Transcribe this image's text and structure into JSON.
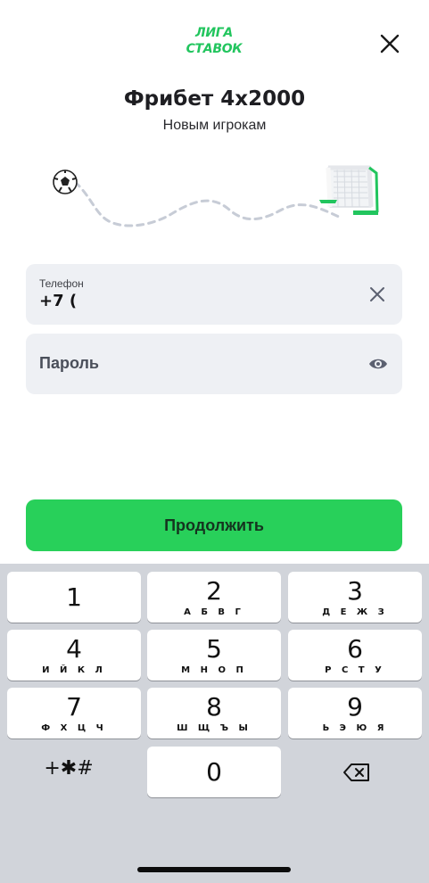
{
  "header": {
    "logo_text": "ЛИГА СТАВОК",
    "close_icon": "close-icon",
    "title": "Фрибет 4х2000",
    "subtitle": "Новым игрокам"
  },
  "illustration": {
    "ball_icon": "soccer-ball-icon",
    "goal_icon": "goal-net-icon"
  },
  "phone_field": {
    "label": "Телефон",
    "value": "+7 (",
    "clear_icon": "clear-icon"
  },
  "password_field": {
    "placeholder": "Пароль",
    "toggle_icon": "eye-icon"
  },
  "continue_button": {
    "label": "Продолжить"
  },
  "colors": {
    "accent": "#28d05a",
    "logo": "#22c55e",
    "field_bg": "#eef0f4",
    "keyboard_bg": "#d1d4da"
  },
  "keyboard": {
    "keys": [
      {
        "digit": "1",
        "letters": ""
      },
      {
        "digit": "2",
        "letters": "А Б В Г"
      },
      {
        "digit": "3",
        "letters": "Д Е Ж З"
      },
      {
        "digit": "4",
        "letters": "И Й К Л"
      },
      {
        "digit": "5",
        "letters": "М Н О П"
      },
      {
        "digit": "6",
        "letters": "Р С Т У"
      },
      {
        "digit": "7",
        "letters": "Ф Х Ц Ч"
      },
      {
        "digit": "8",
        "letters": "Ш Щ Ъ Ы"
      },
      {
        "digit": "9",
        "letters": "Ь Э Ю Я"
      },
      {
        "digit": "0",
        "letters": ""
      }
    ],
    "symbols_label": "+✱#",
    "delete_icon": "backspace-icon"
  }
}
